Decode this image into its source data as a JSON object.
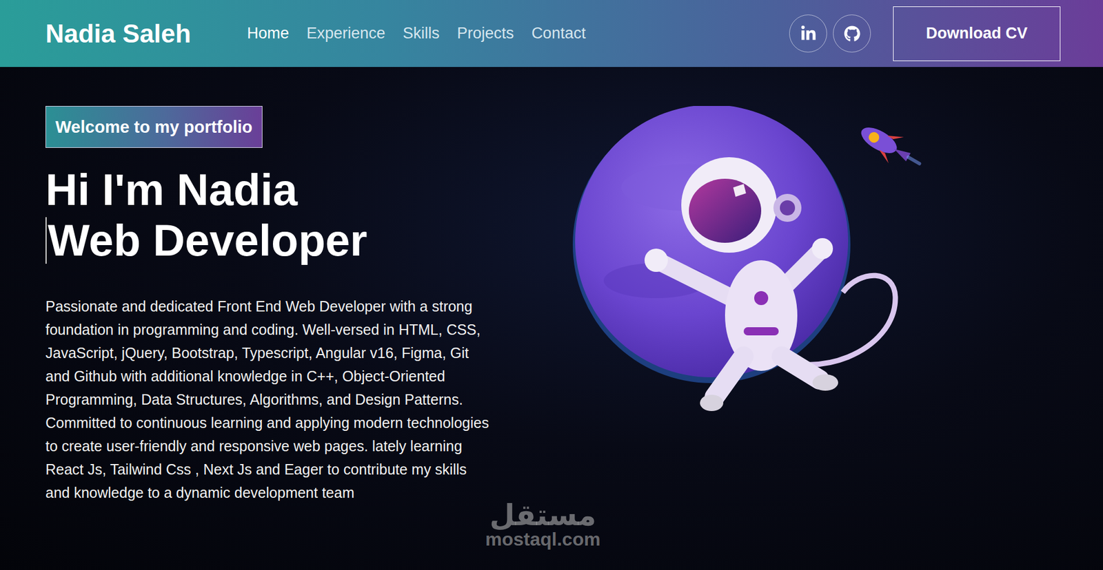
{
  "header": {
    "logo": "Nadia Saleh",
    "nav": [
      {
        "label": "Home",
        "selected": true
      },
      {
        "label": "Experience",
        "selected": false
      },
      {
        "label": "Skills",
        "selected": false
      },
      {
        "label": "Projects",
        "selected": false
      },
      {
        "label": "Contact",
        "selected": false
      }
    ],
    "cta": "Download CV"
  },
  "hero": {
    "badge": "Welcome to my portfolio",
    "title_lines": [
      "Hi I'm Nadia",
      "Web Developer"
    ],
    "description": "Passionate and dedicated Front End Web Developer with a strong foundation in programming and coding. Well-versed in HTML, CSS, JavaScript, jQuery, Bootstrap, Typescript, Angular v16, Figma, Git and Github with additional knowledge in C++, Object-Oriented Programming, Data Structures, Algorithms, and Design Patterns. Committed to continuous learning and applying modern technologies to create user-friendly and responsive web pages. lately learning React Js, Tailwind Css , Next Js and Eager to contribute my skills and knowledge to a dynamic development team"
  },
  "watermark": {
    "arabic": "مستقل",
    "latin": "mostaql.com"
  }
}
